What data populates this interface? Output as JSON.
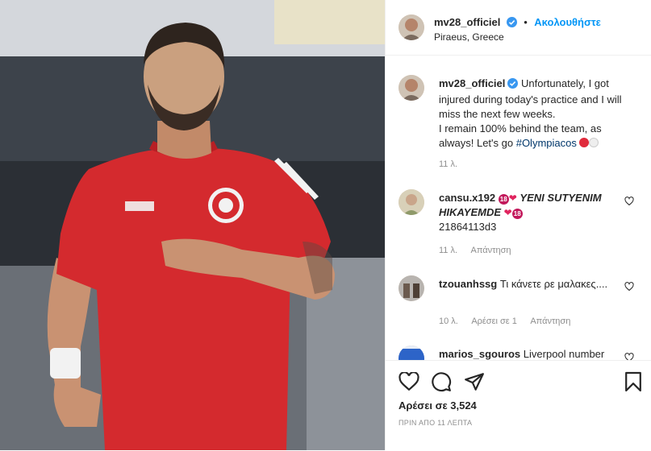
{
  "header": {
    "username": "mv28_officiel",
    "follow_label": "Ακολουθήστε",
    "location": "Piraeus, Greece"
  },
  "caption": {
    "username": "mv28_officiel",
    "text": "Unfortunately, I got injured during today's practice and I will miss the next few weeks.",
    "text2": "I remain 100% behind the team, as always! Let's go",
    "hashtag": "#Olympiacos",
    "time": "11 λ."
  },
  "comments": [
    {
      "username": "cansu.x192",
      "text_a": "YENI",
      "text_b": "SUTYENIM HIKAYEMDE",
      "text_c": "21864113d3",
      "time": "11 λ.",
      "reply": "Απάντηση",
      "badge": "18"
    },
    {
      "username": "tzouanhssg",
      "text": "Τι κάνετε ρε μαλακες....",
      "time": "10 λ.",
      "likes": "Αρέσει σε 1",
      "reply": "Απάντηση"
    },
    {
      "username": "marios_sgouros",
      "text": "Liverpool number"
    }
  ],
  "footer": {
    "likes": "Αρέσει σε 3,524",
    "date": "ΠΡΙΝ ΑΠΟ 11 ΛΕΠΤΑ"
  },
  "colors": {
    "accent": "#0095f6",
    "jersey": "#d42a2e",
    "text": "#262626",
    "muted": "#8e8e8e"
  }
}
